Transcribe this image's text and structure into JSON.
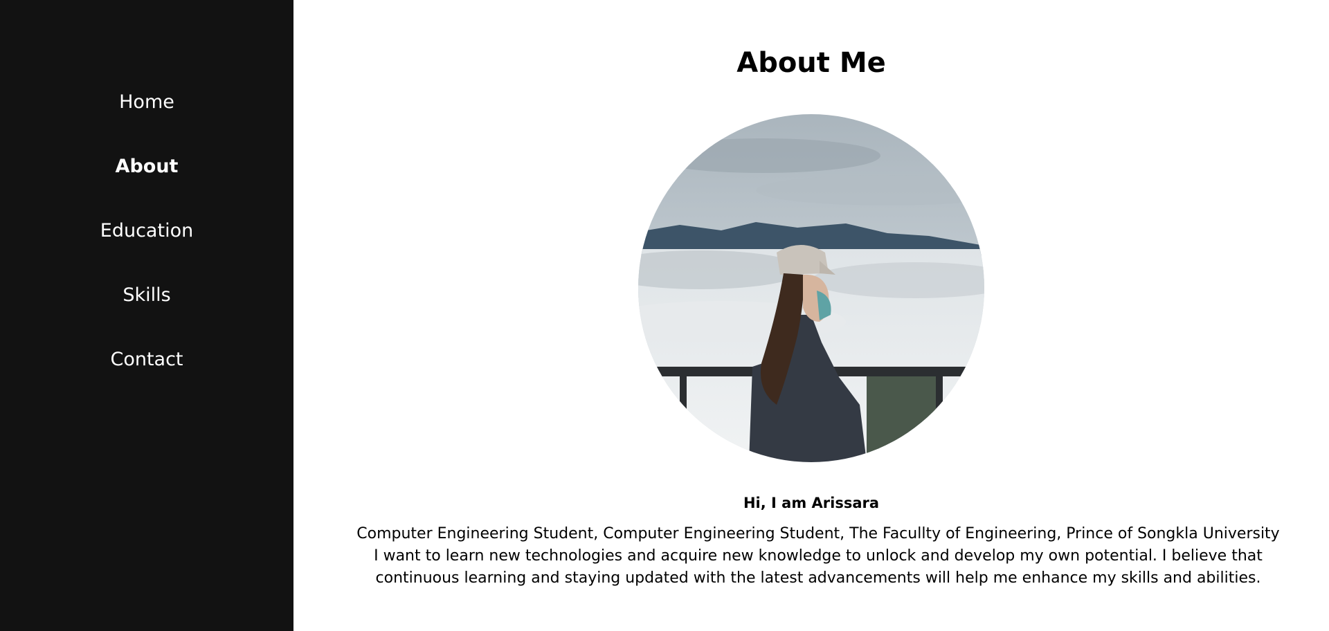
{
  "sidebar": {
    "items": [
      {
        "label": "Home"
      },
      {
        "label": "About"
      },
      {
        "label": "Education"
      },
      {
        "label": "Skills"
      },
      {
        "label": "Contact"
      }
    ],
    "active": "About"
  },
  "main": {
    "title": "About Me",
    "greeting": "Hi, I am Arissara",
    "bio_line_1": "Computer Engineering Student, Computer Engineering Student, The Facullty of Engineering, Prince of Songkla University",
    "bio_line_2": "I want to learn new technologies and acquire new knowledge to unlock and develop my own potential. I believe that continuous learning and staying updated with the latest advancements will help me enhance my skills and abilities."
  },
  "colors": {
    "sidebar_bg": "#121212",
    "sidebar_text": "#ffffff",
    "main_bg": "#ffffff",
    "main_text": "#000000"
  }
}
